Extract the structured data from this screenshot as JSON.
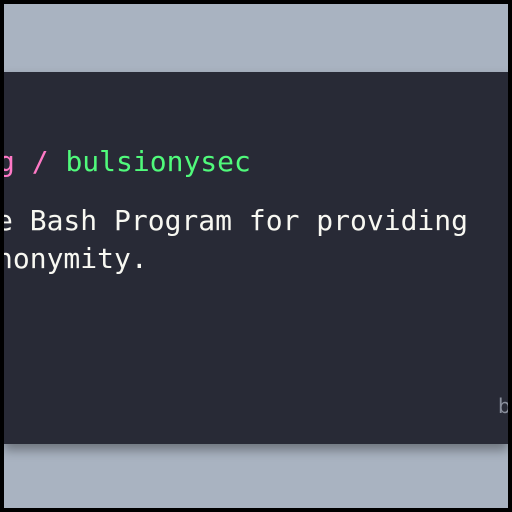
{
  "card": {
    "owner_fragment": "g",
    "separator": " / ",
    "repo_name": "bulsionysec",
    "description_line1": "e Bash Program for providing",
    "description_line2": "nonymity.",
    "corner_fragment": "b"
  },
  "colors": {
    "background": "#a9b3c1",
    "card": "#282a36",
    "owner": "#ff79c6",
    "repo": "#50fa7b",
    "text": "#f8f8f2"
  }
}
